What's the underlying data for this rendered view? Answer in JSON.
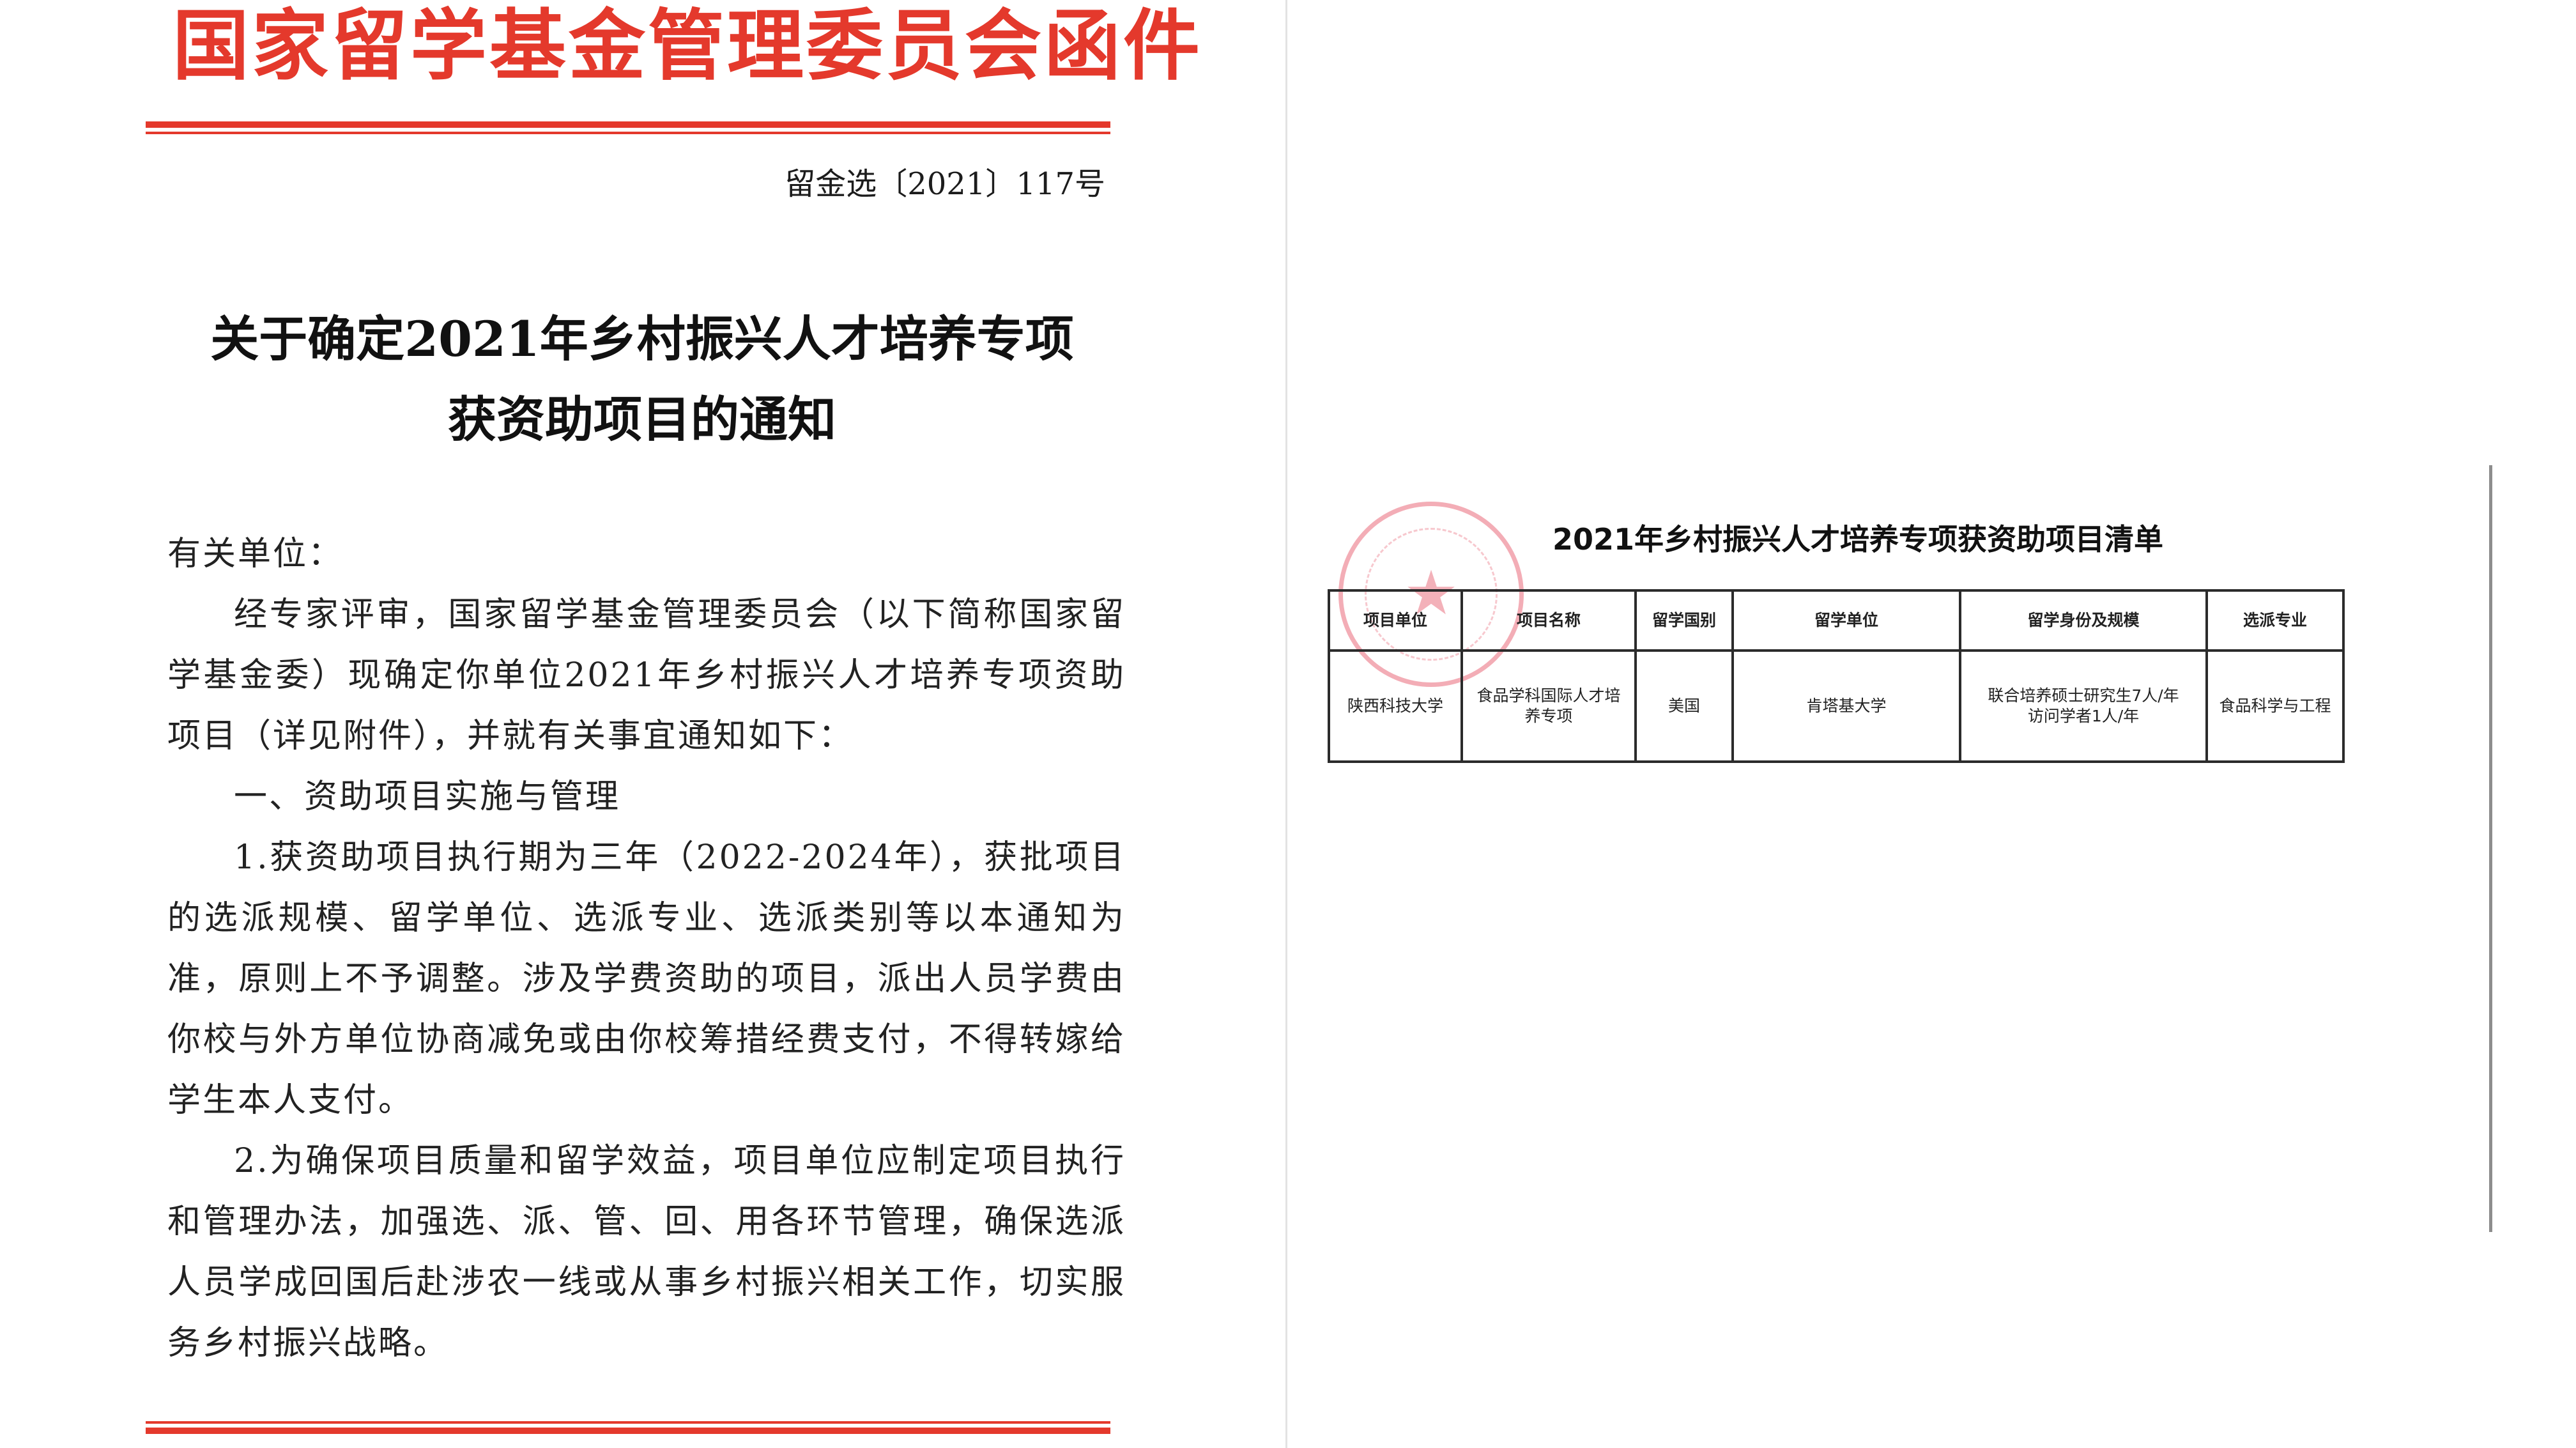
{
  "letterhead": {
    "title": "国家留学基金管理委员会函件",
    "doc_number": "留金选〔2021〕117号",
    "color": "#e4392c"
  },
  "notice": {
    "title_lines": [
      "关于确定2021年乡村振兴人才培养专项",
      "获资助项目的通知"
    ],
    "salutation": "有关单位：",
    "paragraphs": [
      "经专家评审，国家留学基金管理委员会（以下简称国家留学基金委）现确定你单位2021年乡村振兴人才培养专项资助项目（详见附件），并就有关事宜通知如下：",
      "一、资助项目实施与管理",
      "1.获资助项目执行期为三年（2022-2024年），获批项目的选派规模、留学单位、选派专业、选派类别等以本通知为准，原则上不予调整。涉及学费资助的项目，派出人员学费由你校与外方单位协商减免或由你校筹措经费支付，不得转嫁给学生本人支付。",
      "2.为确保项目质量和留学效益，项目单位应制定项目执行和管理办法，加强选、派、管、回、用各环节管理，确保选派人员学成回国后赴涉农一线或从事乡村振兴相关工作，切实服务乡村振兴战略。"
    ]
  },
  "attachment": {
    "title": "2021年乡村振兴人才培养专项获资助项目清单",
    "seal_color": "#e23c50",
    "headers": [
      "项目单位",
      "项目名称",
      "留学国别",
      "留学单位",
      "留学身份及规模",
      "选派专业"
    ],
    "row": {
      "unit": "陕西科技大学",
      "project_name_lines": [
        "食品学科国际人才培",
        "养专项"
      ],
      "country": "美国",
      "host": "肯塔基大学",
      "scale_lines": [
        "联合培养硕士研究生7人/年",
        "访问学者1人/年"
      ],
      "major": "食品科学与工程"
    }
  }
}
